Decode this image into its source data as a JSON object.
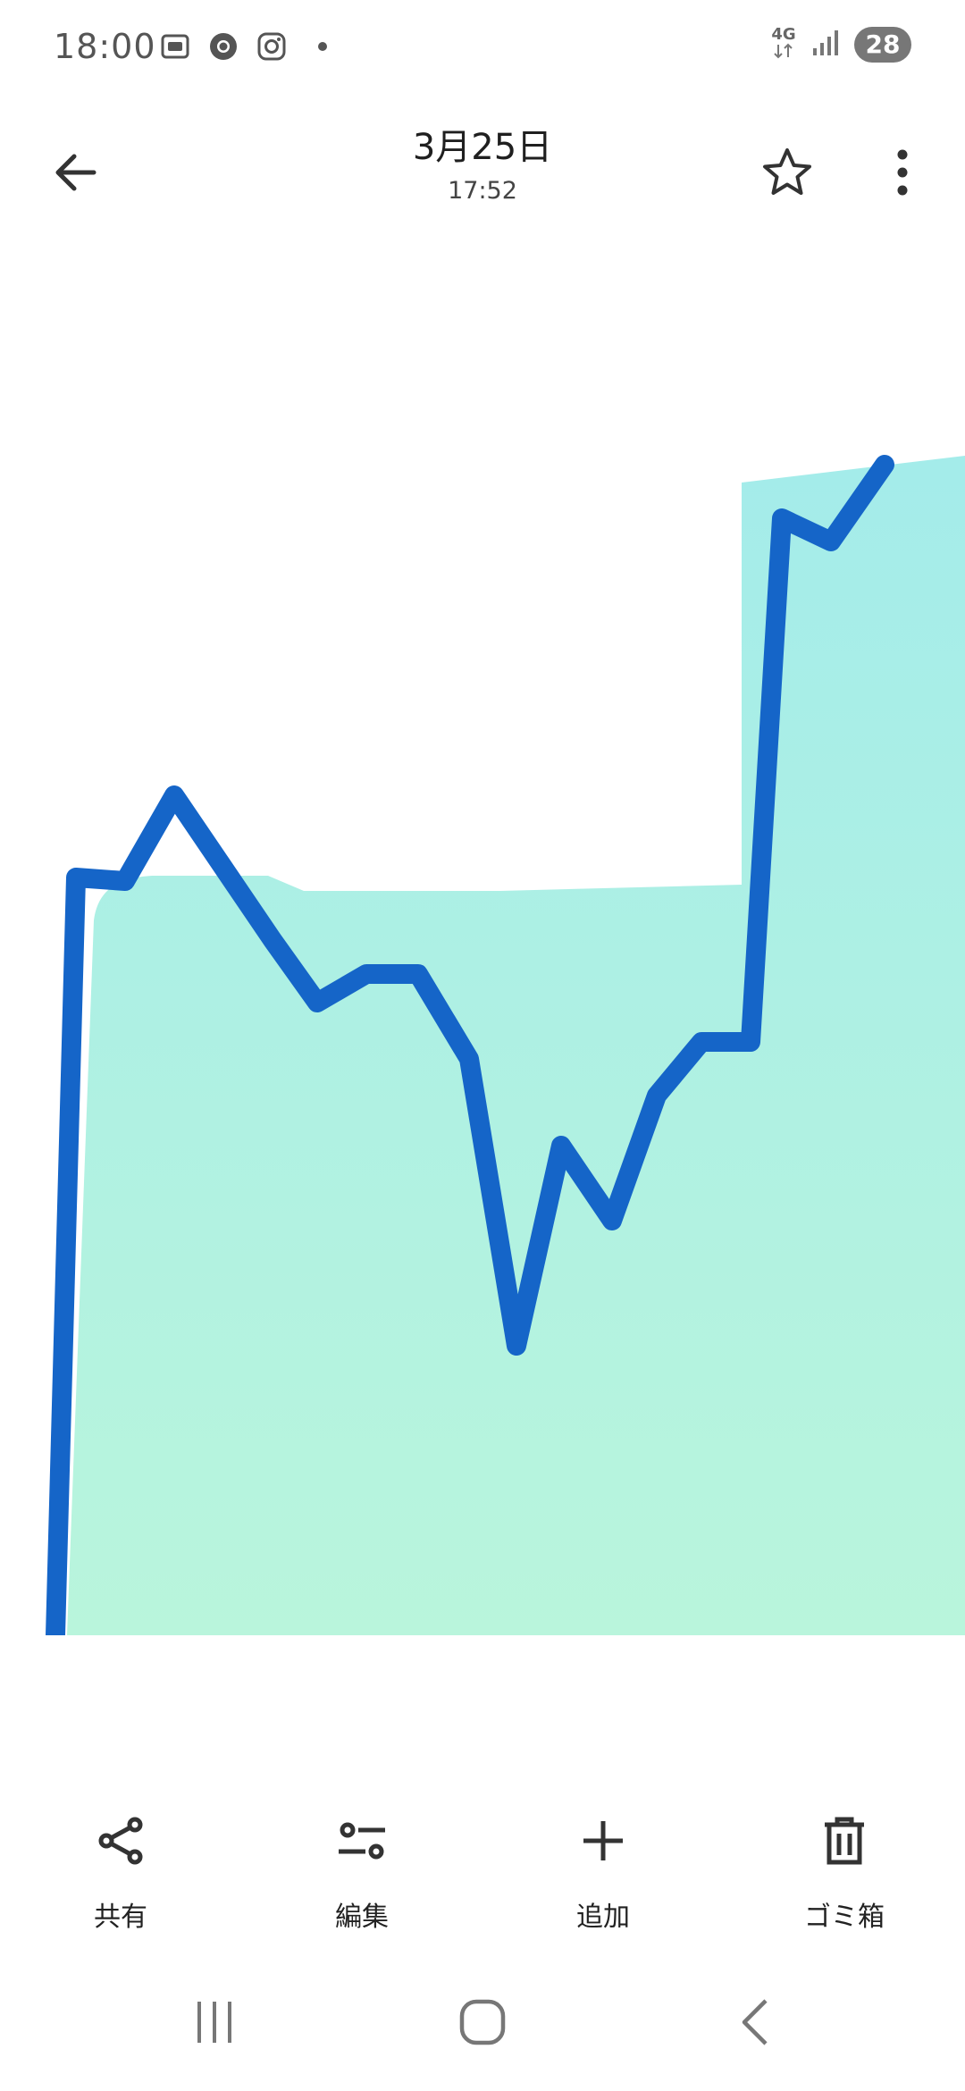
{
  "status_bar": {
    "time": "18:00",
    "network": "4G",
    "battery": "28",
    "icons_left": [
      "screenshot-icon",
      "chrome-icon",
      "instagram-icon",
      "notification-dot"
    ],
    "icons_right": [
      "network-4g-icon",
      "signal-icon",
      "battery-icon"
    ]
  },
  "app_bar": {
    "date": "3月25日",
    "time": "17:52",
    "icons": [
      "back-arrow-icon",
      "star-icon",
      "more-vert-icon"
    ]
  },
  "photo": {
    "line_color": "#1565c8",
    "fill_top_color": "#a4ecea",
    "fill_bottom_color": "#b9f5dc"
  },
  "actions": [
    {
      "label": "共有",
      "icon": "share-icon"
    },
    {
      "label": "編集",
      "icon": "edit-icon"
    },
    {
      "label": "追加",
      "icon": "add-icon"
    },
    {
      "label": "ゴミ箱",
      "icon": "trash-icon"
    }
  ],
  "nav_bar": {
    "icons": [
      "recent-apps-icon",
      "home-icon",
      "back-icon"
    ]
  }
}
